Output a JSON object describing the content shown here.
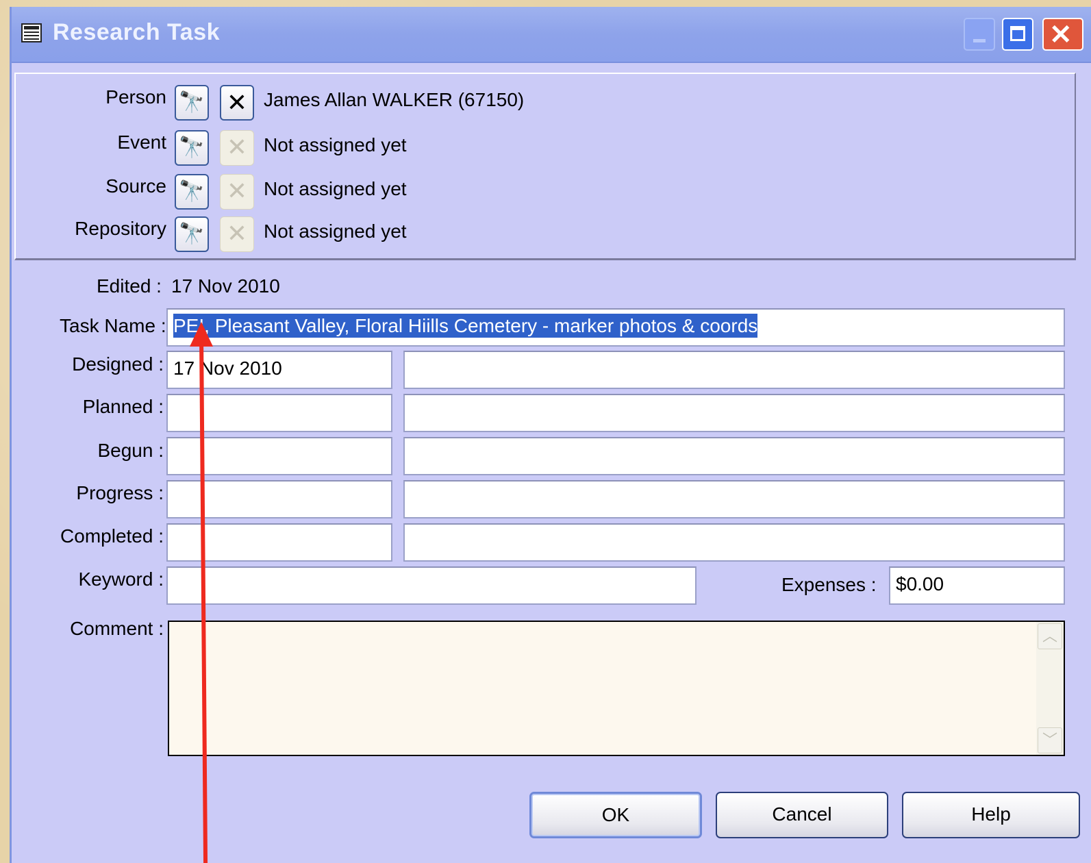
{
  "window": {
    "title": "Research Task"
  },
  "links": [
    {
      "label": "Person",
      "value": "James Allan WALKER (67150)",
      "clear_enabled": true
    },
    {
      "label": "Event",
      "value": "Not assigned yet",
      "clear_enabled": false
    },
    {
      "label": "Source",
      "value": "Not assigned yet",
      "clear_enabled": false
    },
    {
      "label": "Repository",
      "value": "Not assigned yet",
      "clear_enabled": false
    }
  ],
  "find_icon_glyph": "🔭",
  "clear_icon_glyph": "✕",
  "edited": {
    "label": "Edited :",
    "value": "17 Nov 2010"
  },
  "task_name": {
    "label": "Task Name :",
    "value": "PEI, Pleasant Valley, Floral Hiills Cemetery - marker photos & coords"
  },
  "dates": [
    {
      "label": "Designed :",
      "date": "17 Nov 2010",
      "note": ""
    },
    {
      "label": "Planned :",
      "date": "",
      "note": ""
    },
    {
      "label": "Begun :",
      "date": "",
      "note": ""
    },
    {
      "label": "Progress :",
      "date": "",
      "note": ""
    },
    {
      "label": "Completed :",
      "date": "",
      "note": ""
    }
  ],
  "keyword": {
    "label": "Keyword :",
    "value": ""
  },
  "expenses": {
    "label": "Expenses :",
    "value": "$0.00"
  },
  "comment": {
    "label": "Comment :",
    "value": ""
  },
  "buttons": {
    "ok": "OK",
    "cancel": "Cancel",
    "help": "Help"
  },
  "colors": {
    "dialog_bg": "#cbcbf7",
    "selection": "#2f61ca",
    "annotation_arrow": "#ee2a1f"
  }
}
